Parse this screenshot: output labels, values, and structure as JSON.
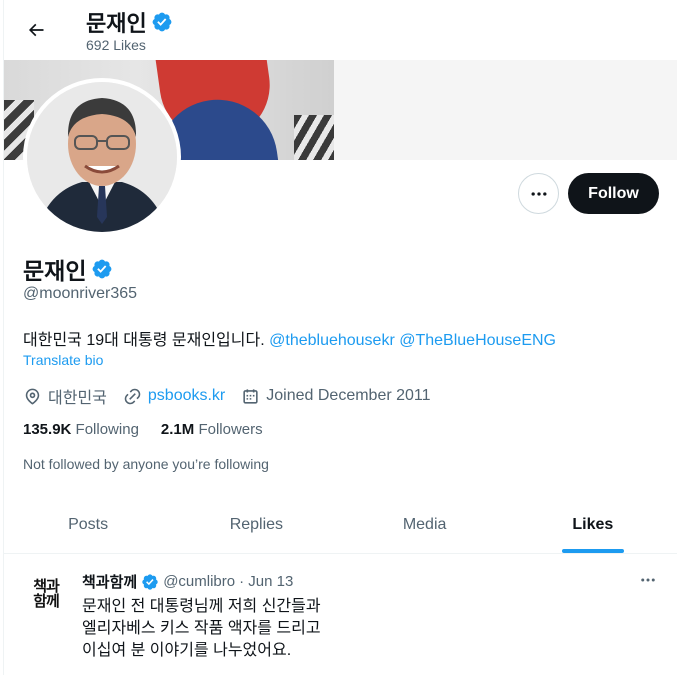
{
  "header": {
    "name": "문재인",
    "count": "692 Likes"
  },
  "profile": {
    "display_name": "문재인",
    "handle": "@moonriver365",
    "bio_text": "대한민국 19대 대통령 문재인입니다.",
    "bio_mention_1": "@thebluehousekr",
    "bio_mention_2": "@TheBlueHouseENG",
    "translate_label": "Translate bio",
    "location": "대한민국",
    "website": "psbooks.kr",
    "joined": "Joined December 2011",
    "following_count": "135.9K",
    "following_label": "Following",
    "followers_count": "2.1M",
    "followers_label": "Followers",
    "not_followed": "Not followed by anyone you’re following"
  },
  "buttons": {
    "follow_label": "Follow"
  },
  "tabs": [
    {
      "label": "Posts"
    },
    {
      "label": "Replies"
    },
    {
      "label": "Media"
    },
    {
      "label": "Likes"
    }
  ],
  "tweet": {
    "avatar_text_1": "책과",
    "avatar_text_2": "함께",
    "name": "책과함께",
    "handle": "@cumlibro",
    "date": "· Jun 13",
    "body": "문재인 전 대통령님께 저희 신간들과\n엘리자베스 키스 작품 액자를 드리고\n이십여 분 이야기를 나누었어요."
  },
  "colors": {
    "accent": "#1d9bf0",
    "text": "#0f1419",
    "secondary": "#536471",
    "verified": "#1d9bf0"
  }
}
